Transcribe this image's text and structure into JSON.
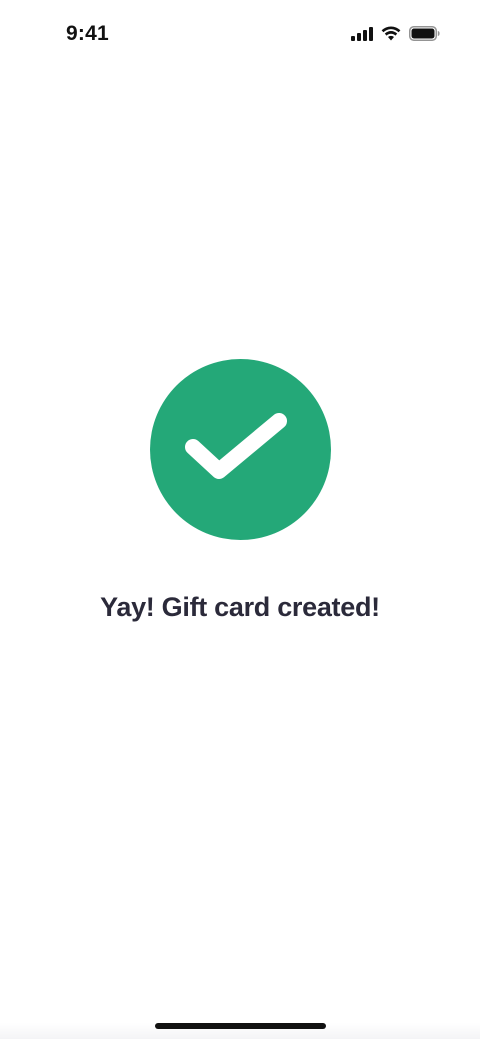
{
  "status_bar": {
    "time": "9:41",
    "icons": [
      "cellular-signal-icon",
      "wifi-icon",
      "battery-icon"
    ]
  },
  "success": {
    "icon": "checkmark-icon",
    "title": "Yay! Gift card created!"
  },
  "colors": {
    "success_green": "#24a878",
    "title_text": "#2b2a3a"
  }
}
